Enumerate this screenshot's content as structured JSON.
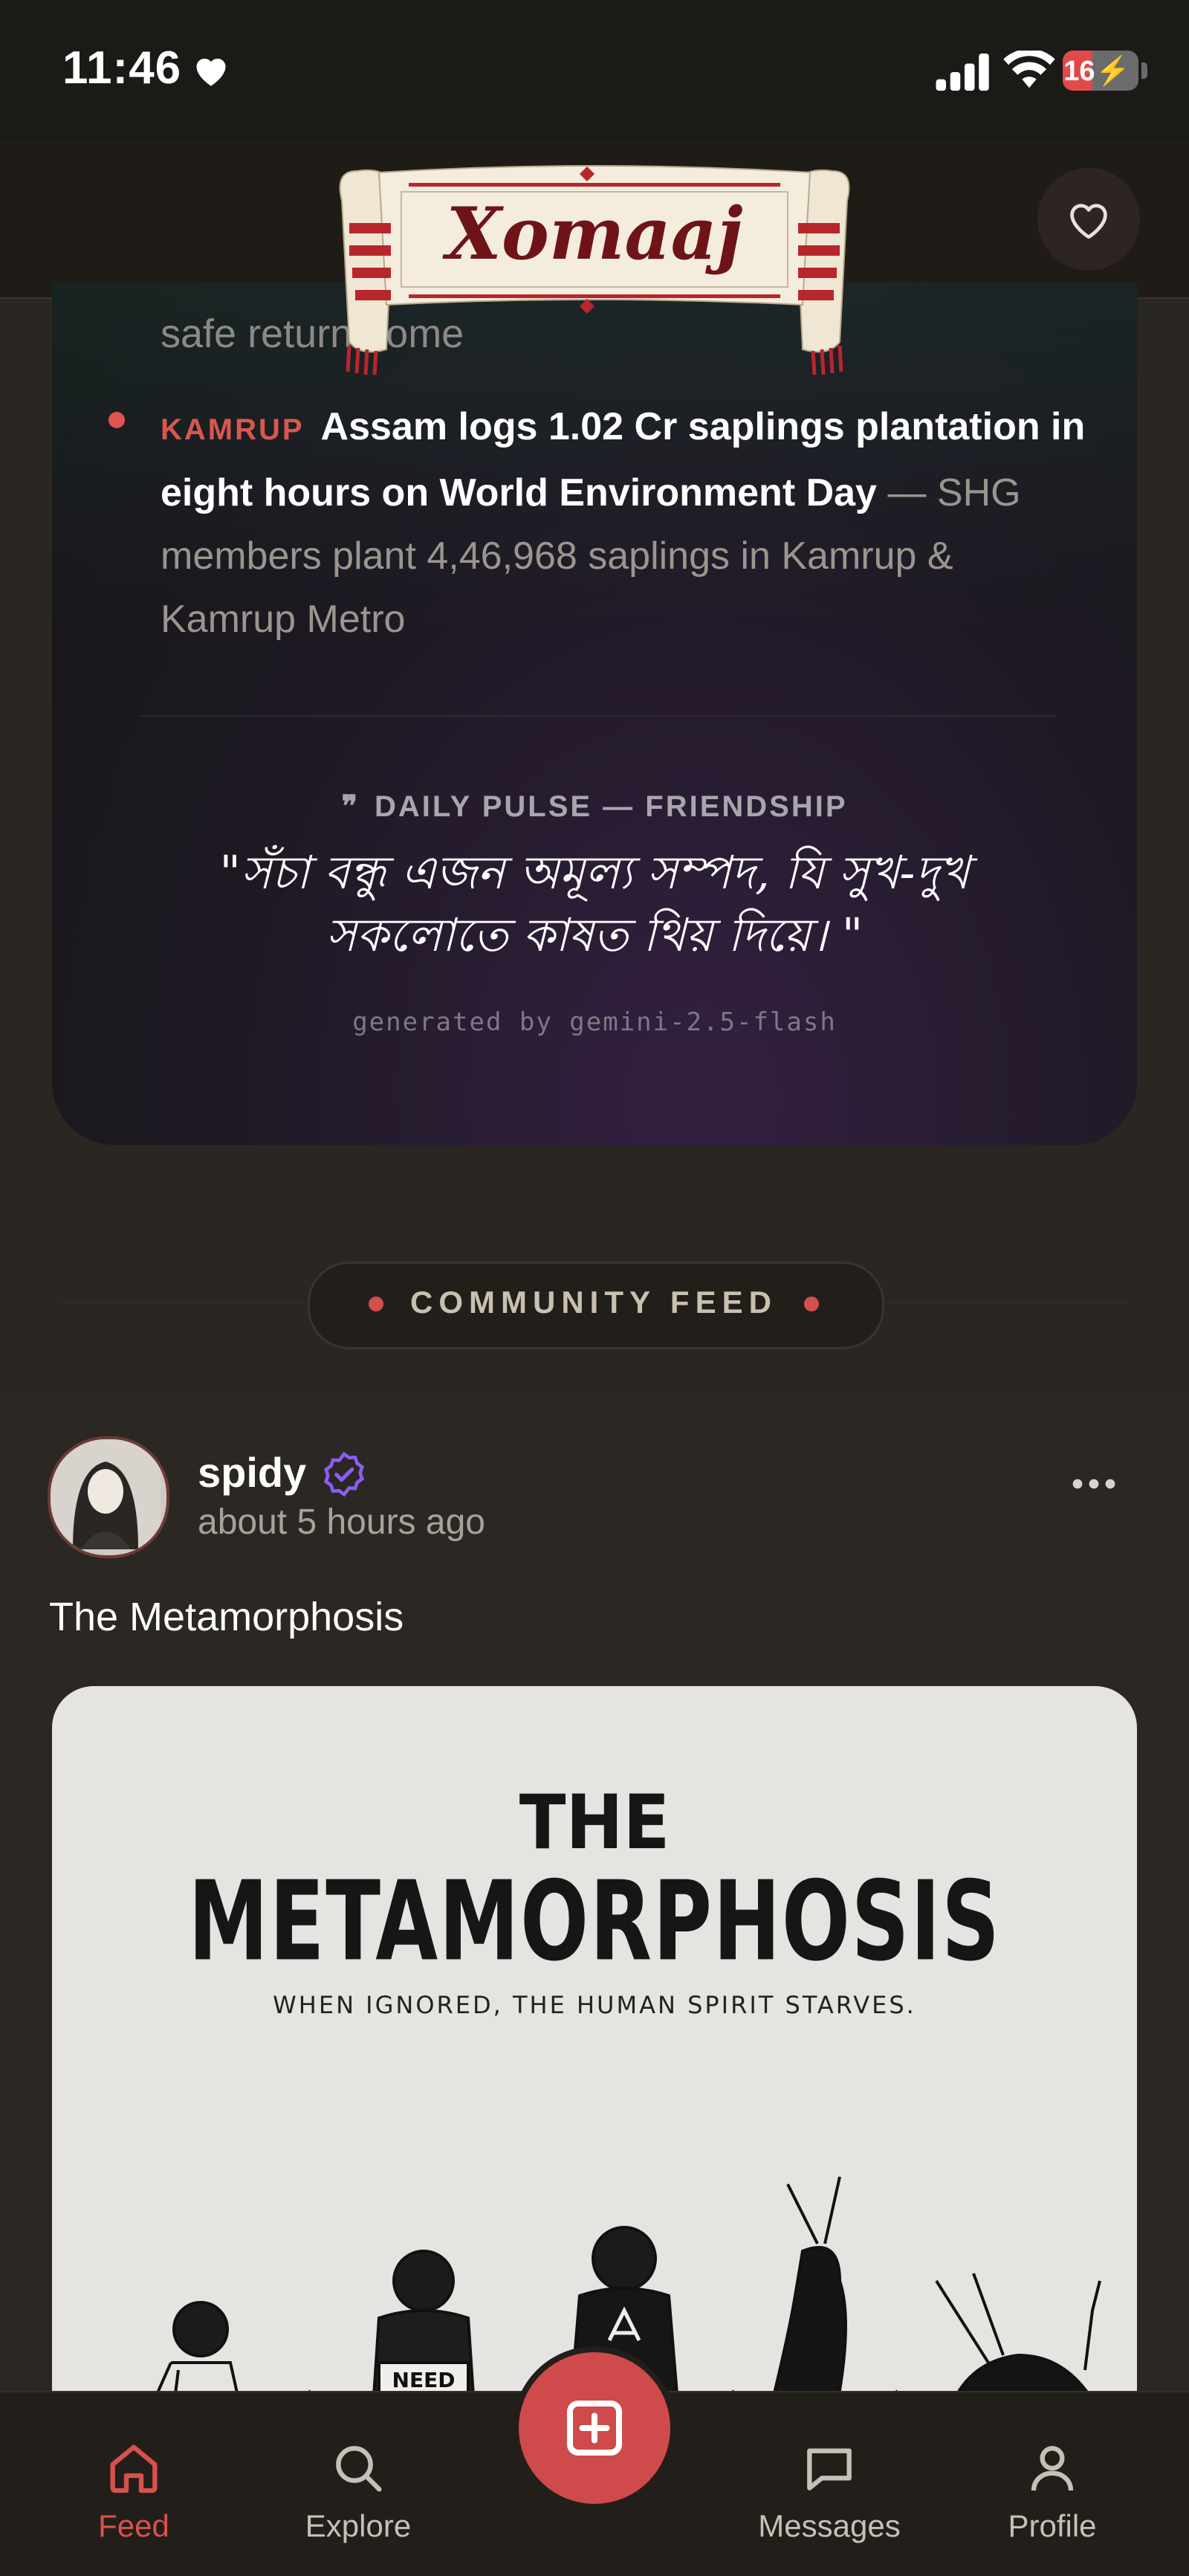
{
  "status_bar": {
    "time": "11:46",
    "battery": "16"
  },
  "header": {
    "logo_text": "Xomaaj"
  },
  "daily": {
    "faded_text": "safe return home",
    "news": {
      "tag": "KAMRUP",
      "title": "Assam logs 1.02 Cr saplings plantation in eight hours on World Environment Day",
      "desc": "— SHG members plant 4,46,968 saplings in Kamrup & Kamrup Metro"
    },
    "pulse": {
      "heading": "DAILY PULSE — FRIENDSHIP",
      "quote": "\"সঁচা বন্ধু এজন অমূল্য সম্পদ, যি সুখ-দুখ সকলোতে কাষত থিয় দিয়ে। \"",
      "generated_by": "generated by gemini-2.5-flash"
    }
  },
  "feed": {
    "section_label": "COMMUNITY FEED"
  },
  "post": {
    "username": "spidy",
    "time_ago": "about 5 hours ago",
    "text": "The Metamorphosis",
    "image": {
      "line1": "THE",
      "line2": "METAMORPHOSIS",
      "tagline": "WHEN IGNORED, THE HUMAN SPIRIT STARVES.",
      "sign_text": "NEED JOB"
    }
  },
  "nav": {
    "items": [
      {
        "label": "Feed",
        "icon": "home-icon"
      },
      {
        "label": "Explore",
        "icon": "search-icon"
      },
      {
        "label": "Messages",
        "icon": "chat-icon"
      },
      {
        "label": "Profile",
        "icon": "person-icon"
      }
    ],
    "active": "Feed"
  },
  "colors": {
    "accent": "#d9514c",
    "verified": "#8b5cf6",
    "background": "#2a2621"
  }
}
